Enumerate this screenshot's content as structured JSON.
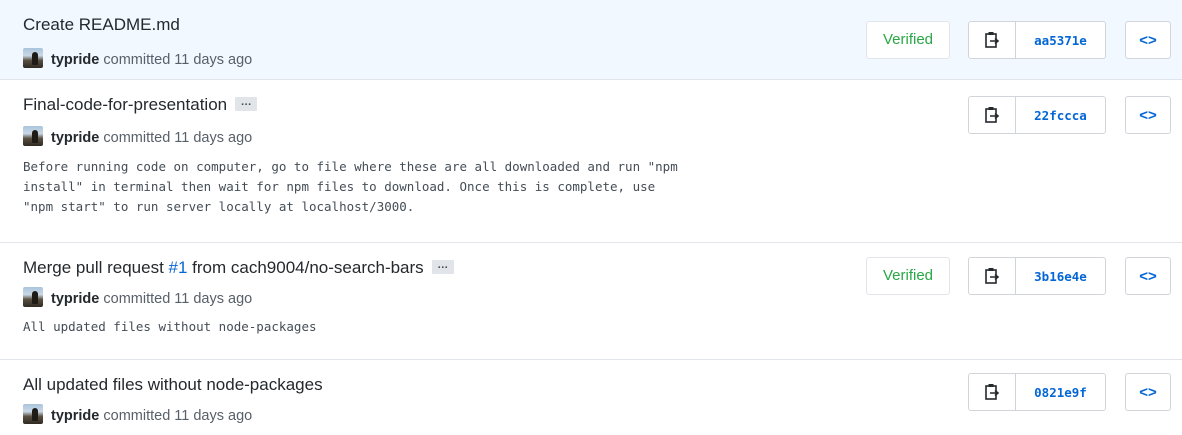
{
  "commits": [
    {
      "title": "Create README.md",
      "author": "typride",
      "committed_text": "committed 11 days ago",
      "verified": "Verified",
      "sha": "aa5371e",
      "description": ""
    },
    {
      "title": "Final-code-for-presentation",
      "author": "typride",
      "committed_text": "committed 11 days ago",
      "verified": "",
      "sha": "22fccca",
      "description": "Before running code on computer, go to file where these are all downloaded and run \"npm\ninstall\" in terminal then wait for npm files to download. Once this is complete, use\n\"npm start\" to run server locally at localhost/3000."
    },
    {
      "title_prefix": "Merge pull request ",
      "title_link": "#1",
      "title_suffix": " from cach9004/no-search-bars",
      "author": "typride",
      "committed_text": "committed 11 days ago",
      "verified": "Verified",
      "sha": "3b16e4e",
      "description": "All updated files without node-packages"
    },
    {
      "title": "All updated files without node-packages",
      "author": "typride",
      "committed_text": "committed 11 days ago",
      "verified": "",
      "sha": "0821e9f",
      "description": ""
    }
  ],
  "ellipsis_label": "…",
  "browse_label": "<>",
  "colors": {
    "highlight_bg": "#f1f8ff",
    "verified_green": "#28a745",
    "link_blue": "#0366d6"
  },
  "icons": [
    "clipboard-icon",
    "code-icon"
  ]
}
